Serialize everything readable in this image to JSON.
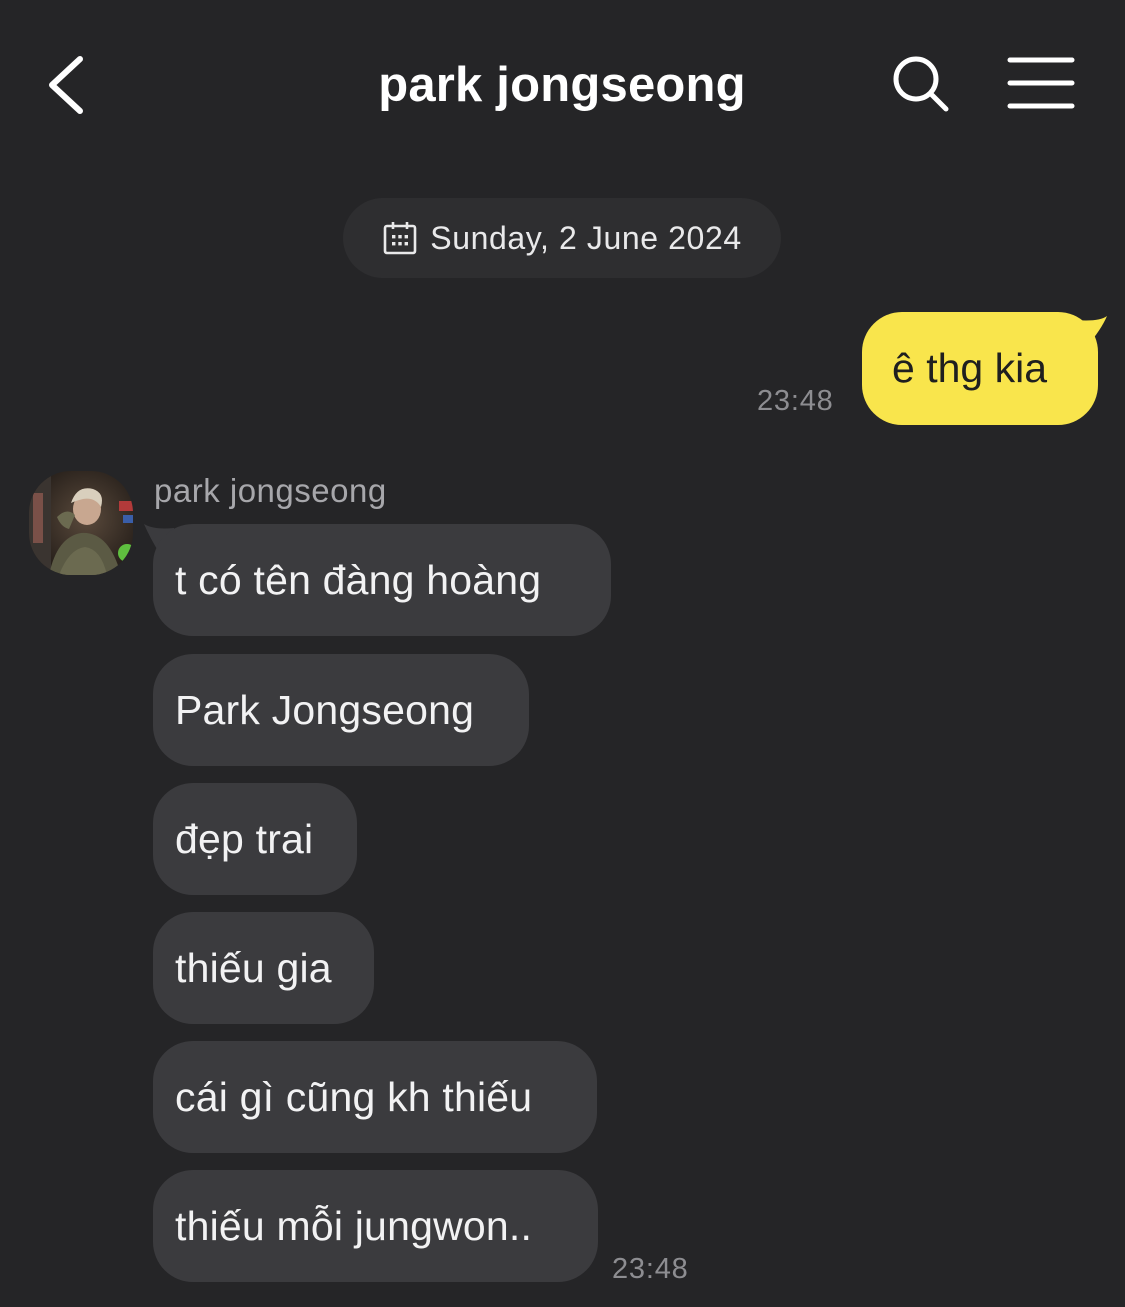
{
  "header": {
    "title": "park jongseong",
    "back_icon": "chevron-left-icon",
    "search_icon": "search-icon",
    "menu_icon": "hamburger-menu-icon"
  },
  "date_divider": {
    "icon": "calendar-icon",
    "text": "Sunday, 2 June 2024"
  },
  "outgoing": {
    "text": "ê thg kia",
    "time": "23:48",
    "bubble_color": "#f9e54c"
  },
  "incoming": {
    "sender": "park jongseong",
    "messages": [
      "t có tên đàng hoàng",
      "Park Jongseong",
      "đẹp trai",
      "thiếu gia",
      "cái gì cũng kh thiếu",
      "thiếu mỗi jungwon.."
    ],
    "time": "23:48",
    "bubble_color": "#3b3b3e"
  },
  "colors": {
    "background": "#252527",
    "accent_yellow": "#f9e54c"
  }
}
